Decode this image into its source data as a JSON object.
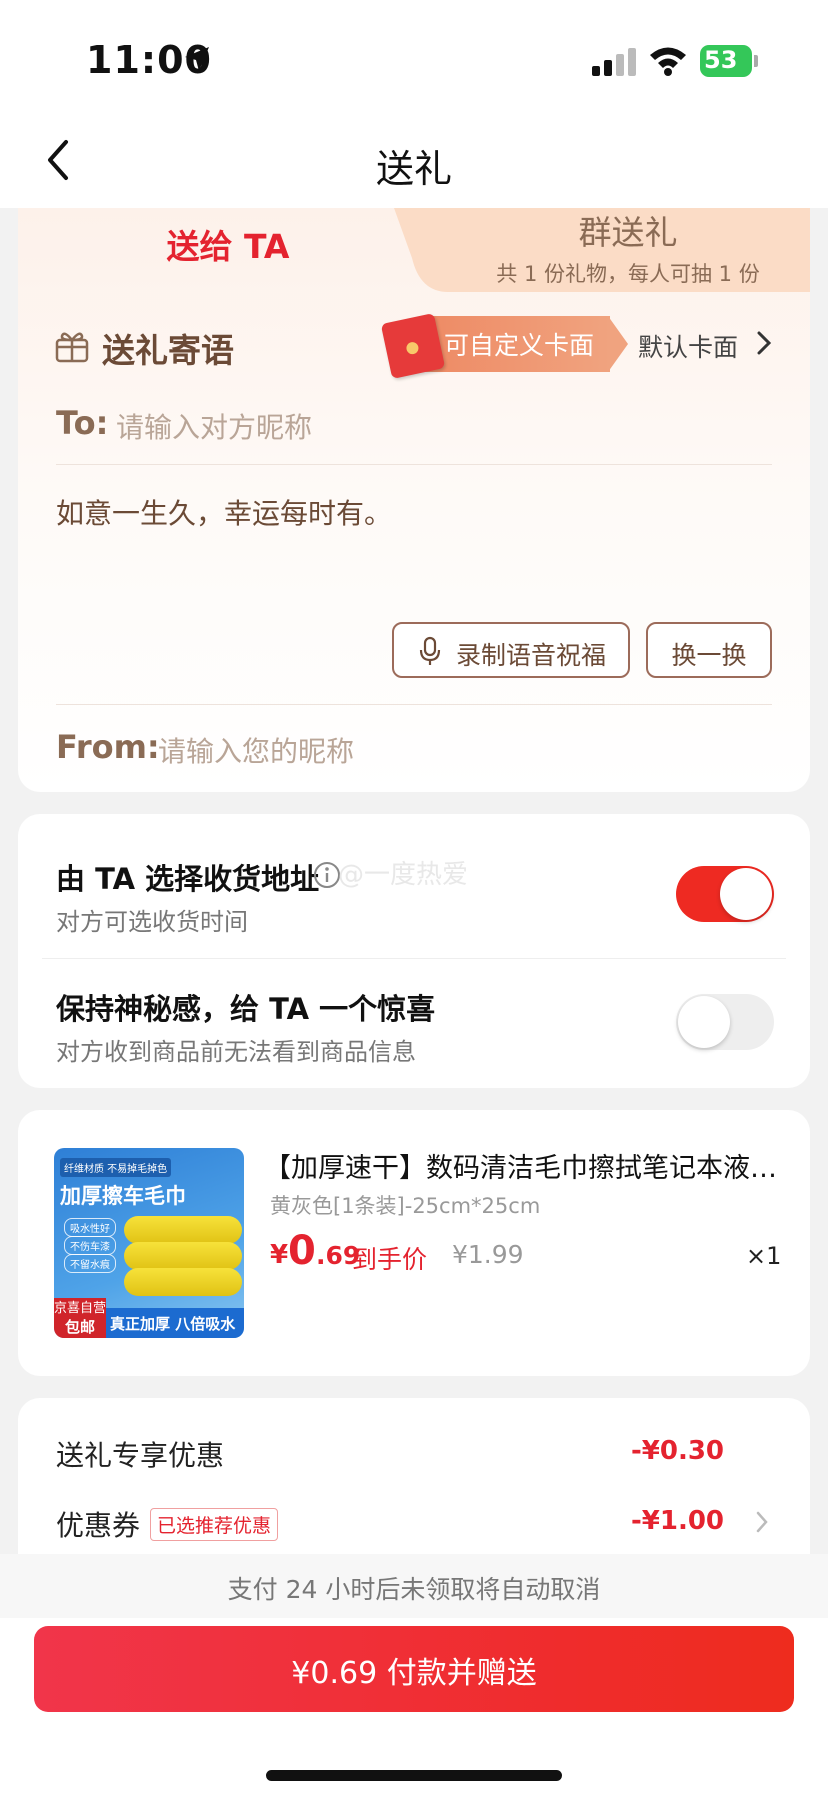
{
  "status_bar": {
    "time": "11:00",
    "battery": "53"
  },
  "nav": {
    "title": "送礼"
  },
  "tabs": {
    "solo": "送给 TA",
    "group": "群送礼",
    "group_sub": "共 1 份礼物，每人可抽 1 份"
  },
  "message": {
    "title": "送礼寄语",
    "custom_card": "可自定义卡面",
    "default_card": "默认卡面",
    "to_label": "To:",
    "to_placeholder": "请输入对方昵称",
    "wish_text": "如意一生久，幸运每时有。",
    "voice_button": "录制语音祝福",
    "swap_button": "换一换",
    "from_label": "From:",
    "from_placeholder": "请输入您的昵称"
  },
  "options": [
    {
      "title": "由 TA 选择收货地址",
      "sub": "对方可选收货时间",
      "on": true
    },
    {
      "title": "保持神秘感，给 TA 一个惊喜",
      "sub": "对方收到商品前无法看到商品信息",
      "on": false
    }
  ],
  "watermark": "@一度热爱",
  "product": {
    "name": "【加厚速干】数码清洁毛巾擦拭笔记本液晶屏幕",
    "spec": "黄灰色[1条装]-25cm*25cm",
    "price_symbol": "¥",
    "price_int": "0",
    "price_dec": ".69",
    "price_label": "到手价",
    "orig_price": "¥1.99",
    "qty": "×1",
    "image": {
      "banner": "纤维材质 不易掉毛掉色",
      "headline": "加厚擦车毛巾",
      "features": [
        "吸水性好",
        "不伤车漆",
        "不留水痕"
      ],
      "tag_line1": "京喜自营",
      "tag_line2": "包邮",
      "strip": "真正加厚 八倍吸水"
    }
  },
  "discounts": [
    {
      "label": "送礼专享优惠",
      "value": "-¥0.30"
    },
    {
      "label": "优惠券",
      "tag": "已选推荐优惠",
      "value": "-¥1.00"
    }
  ],
  "footer": {
    "notice": "支付 24 小时后未领取将自动取消",
    "pay_button": "¥0.69 付款并赠送"
  },
  "colors": {
    "accent": "#e4232f",
    "brown": "#6b4a36",
    "toggle_on": "#ee2a22"
  }
}
